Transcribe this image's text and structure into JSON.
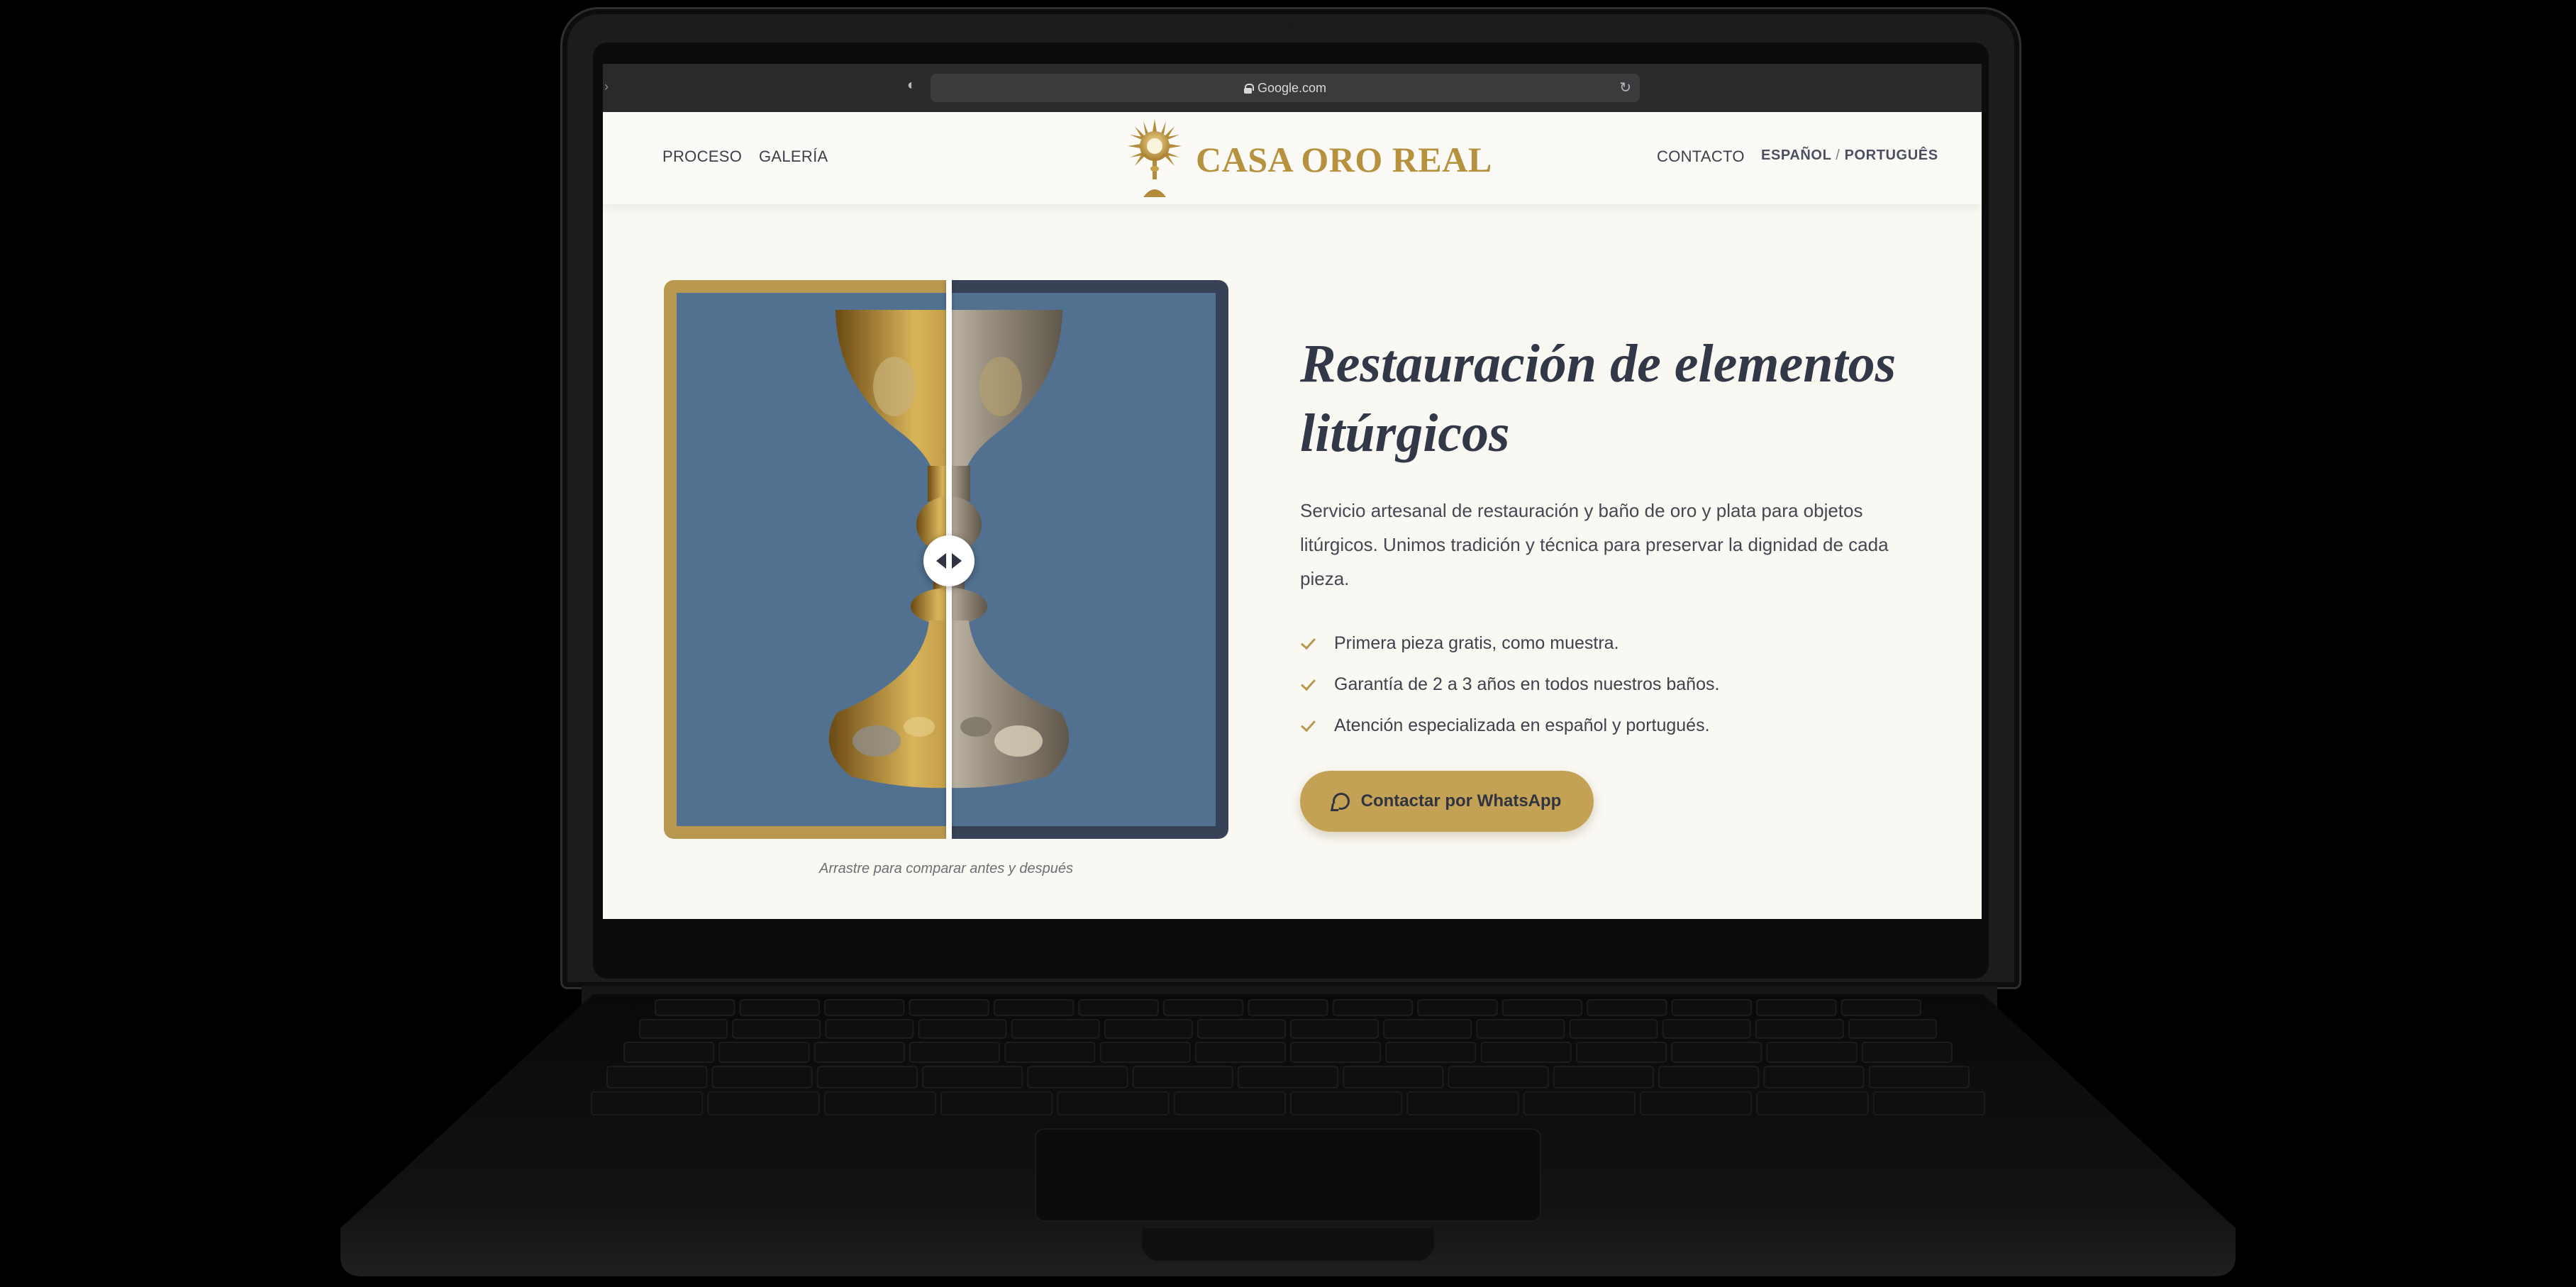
{
  "browser": {
    "url": "Google.com"
  },
  "nav": {
    "left_links": [
      "PROCESO",
      "GALERÍA"
    ],
    "brand": "CASA ORO REAL",
    "contact": "CONTACTO",
    "lang_es": "ESPAÑOL",
    "lang_sep": "/",
    "lang_pt": "PORTUGUÊS"
  },
  "hero": {
    "headline_line1": "Restauración de elementos",
    "headline_line2": "litúrgicos",
    "lead": "Servicio artesanal de restauración y baño de oro y plata para objetos litúrgicos. Unimos tradición y técnica para preservar la dignidad de cada pieza.",
    "features": [
      "Primera pieza gratis, como muestra.",
      "Garantía de 2 a 3 años en todos nuestros baños.",
      "Atención especializada en español y portugués."
    ],
    "cta_label": "Contactar por WhatsApp",
    "compare_caption": "Arrastre para comparar antes y después",
    "compare_position": 0.5
  },
  "icons": {
    "check": "check-icon",
    "whatsapp": "whatsapp-icon",
    "compare_handle": "arrows-left-right-icon",
    "lock": "lock-icon",
    "reload": "reload-icon",
    "privacy": "shield-icon"
  },
  "colors": {
    "gold": "#b8974f",
    "cta_gold": "#c4a255",
    "navy_text": "#323847",
    "page_bg": "#faf8f3",
    "image_bg": "#52708f"
  }
}
